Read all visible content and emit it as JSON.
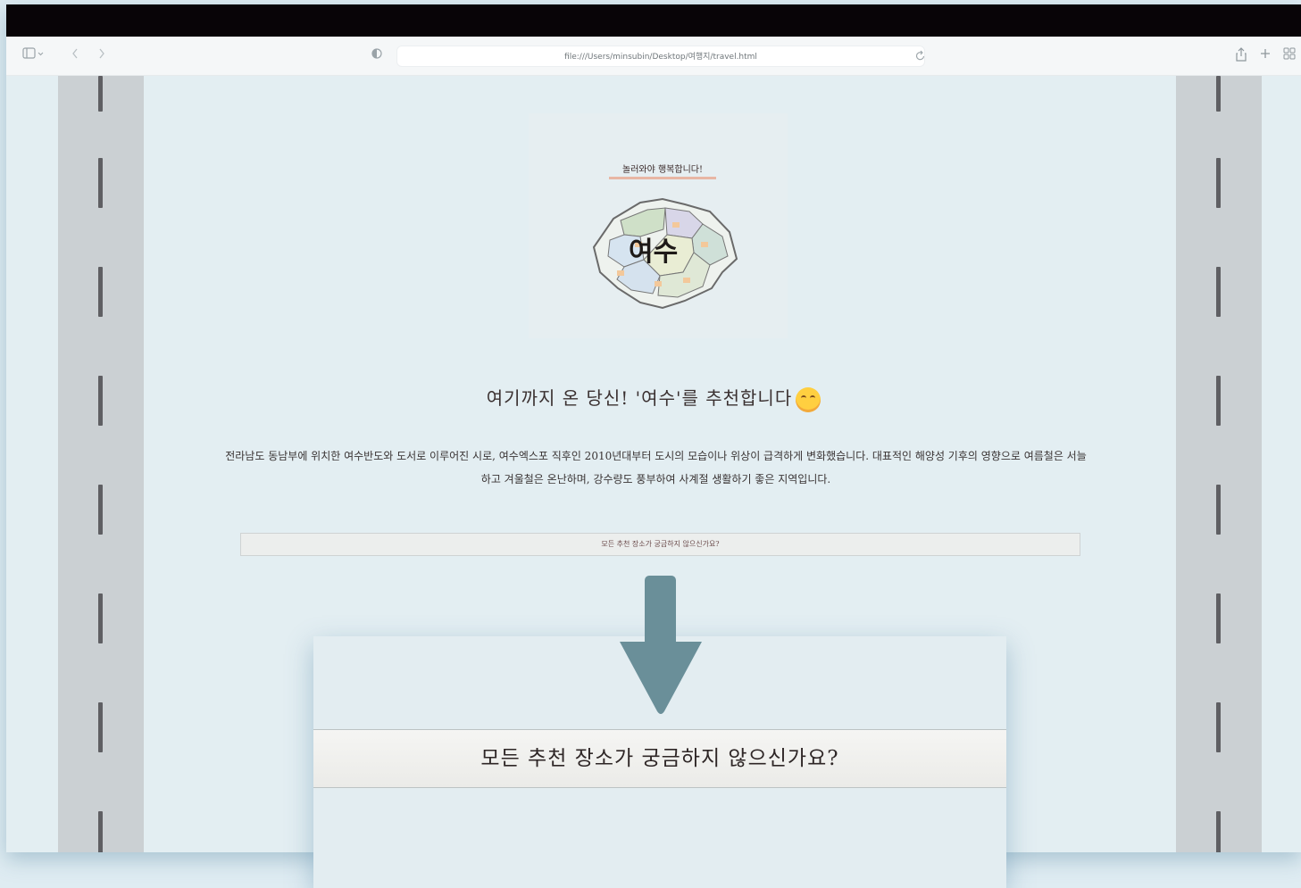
{
  "browser": {
    "url": "file:///Users/minsubin/Desktop/여행지/travel.html",
    "icons": {
      "sidebar": "sidebar-icon",
      "back": "back-icon",
      "forward": "forward-icon",
      "privacy": "privacy-shield-icon",
      "reload": "reload-icon",
      "share": "share-icon",
      "new_tab": "plus-icon",
      "tabs": "tab-overview-icon"
    }
  },
  "page": {
    "logo": {
      "banner": "놀러와야 행복합니다!",
      "word": "여수"
    },
    "heading": "여기까지 온 당신! '여수'를 추천합니다",
    "heading_emoji": "smiling-face-icon",
    "description": "전라남도 동남부에 위치한 여수반도와 도서로 이루어진 시로, 여수엑스포 직후인 2010년대부터 도시의 모습이나 위상이 급격하게 변화했습니다. 대표적인 해양성 기후의 영향으로 여름철은 서늘하고 겨울철은 온난하며, 강수량도 풍부하여 사계절 생활하기 좋은 지역입니다.",
    "all_places_button": "모든 추천 장소가 궁금하지 않으신가요?"
  },
  "zoom": {
    "button_label": "모든 추천 장소가 궁금하지 않으신가요?",
    "arrow": "down-arrow-icon"
  },
  "colors": {
    "titlebar": "#080407",
    "page_bg": "#e3eef2",
    "road": "#cbd0d3",
    "lane": "#5f5f63",
    "arrow": "#6a8f99"
  }
}
